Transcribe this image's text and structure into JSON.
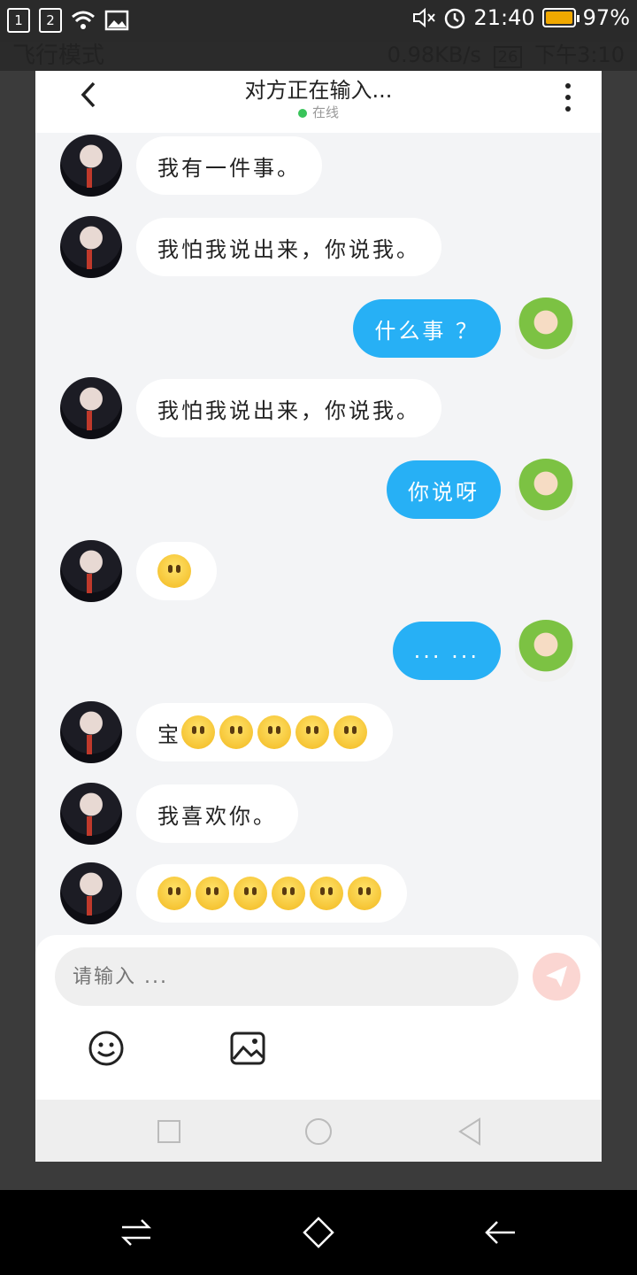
{
  "status_bar": {
    "sim1": "1",
    "sim2": "2",
    "time": "21:40",
    "battery": "97%"
  },
  "ghost_status": {
    "left": "飞行模式",
    "speed": "0.98KB/s",
    "time": "下午3:10",
    "badge": "26"
  },
  "header": {
    "title": "对方正在输入...",
    "status": "在线"
  },
  "messages": [
    {
      "side": "in",
      "text": "我有一件事。"
    },
    {
      "side": "in",
      "text": "我怕我说出来，你说我。"
    },
    {
      "side": "out",
      "text": "什么事 ？"
    },
    {
      "side": "in",
      "text": "我怕我说出来，你说我。"
    },
    {
      "side": "out",
      "text": "你说呀"
    },
    {
      "side": "in",
      "text": "",
      "emoji_count": 1
    },
    {
      "side": "out",
      "text": "... ..."
    },
    {
      "side": "in",
      "text": "宝",
      "emoji_count": 5
    },
    {
      "side": "in",
      "text": "我喜欢你。"
    },
    {
      "side": "in",
      "text": "",
      "emoji_count": 6
    }
  ],
  "composer": {
    "placeholder": "请输入 ..."
  },
  "colors": {
    "accent": "#27b0f5",
    "send_disabled": "#fbd6d2"
  },
  "icons": [
    "back-icon",
    "more-icon",
    "send-icon",
    "emoji-icon",
    "image-icon",
    "square-icon",
    "home-icon",
    "back-triangle-icon"
  ]
}
